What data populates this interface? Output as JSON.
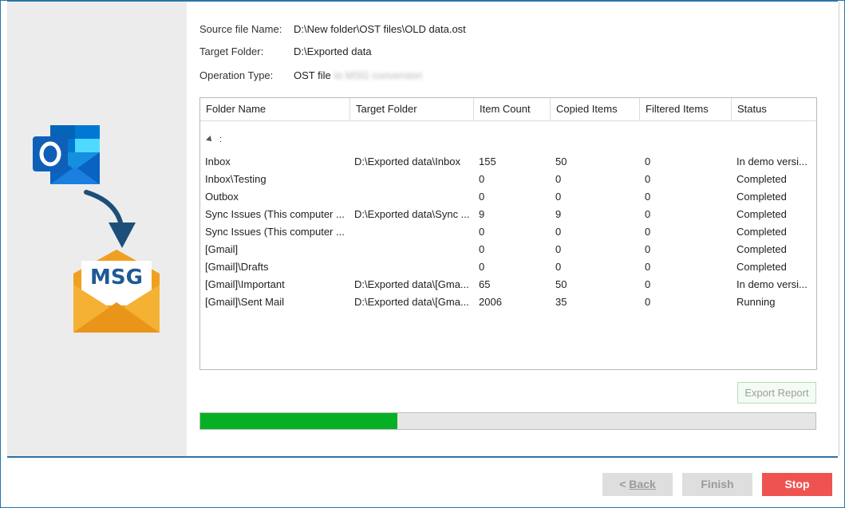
{
  "info": {
    "source_label": "Source file Name:",
    "source_value": "D:\\New folder\\OST files\\OLD data.ost",
    "target_label": "Target Folder:",
    "target_value": "D:\\Exported data",
    "operation_label": "Operation Type:",
    "operation_value": "OST file",
    "operation_blurred": "to MSG conversion"
  },
  "table": {
    "columns": [
      "Folder Name",
      "Target Folder",
      "Item Count",
      "Copied Items",
      "Filtered Items",
      "Status"
    ],
    "group_label": ":",
    "rows": [
      {
        "folder": "Inbox",
        "target": "D:\\Exported data\\Inbox",
        "count": "155",
        "copied": "50",
        "filtered": "0",
        "status": "In demo versi..."
      },
      {
        "folder": "Inbox\\Testing",
        "target": "",
        "count": "0",
        "copied": "0",
        "filtered": "0",
        "status": "Completed"
      },
      {
        "folder": "Outbox",
        "target": "",
        "count": "0",
        "copied": "0",
        "filtered": "0",
        "status": "Completed"
      },
      {
        "folder": "Sync Issues (This computer ...",
        "target": "D:\\Exported data\\Sync ...",
        "count": "9",
        "copied": "9",
        "filtered": "0",
        "status": "Completed"
      },
      {
        "folder": "Sync Issues (This computer ...",
        "target": "",
        "count": "0",
        "copied": "0",
        "filtered": "0",
        "status": "Completed"
      },
      {
        "folder": "[Gmail]",
        "target": "",
        "count": "0",
        "copied": "0",
        "filtered": "0",
        "status": "Completed"
      },
      {
        "folder": "[Gmail]\\Drafts",
        "target": "",
        "count": "0",
        "copied": "0",
        "filtered": "0",
        "status": "Completed"
      },
      {
        "folder": "[Gmail]\\Important",
        "target": "D:\\Exported data\\[Gma...",
        "count": "65",
        "copied": "50",
        "filtered": "0",
        "status": "In demo versi..."
      },
      {
        "folder": "[Gmail]\\Sent Mail",
        "target": "D:\\Exported data\\[Gma...",
        "count": "2006",
        "copied": "35",
        "filtered": "0",
        "status": "Running"
      }
    ]
  },
  "export_report_label": "Export Report",
  "progress_fraction": 0.32,
  "buttons": {
    "back_prefix": "< ",
    "back_label": "Back",
    "finish_label": "Finish",
    "stop_label": "Stop"
  },
  "illustration": {
    "badge_text": "MSG",
    "icons": [
      "outlook-icon",
      "curved-arrow-icon",
      "msg-envelope-icon"
    ]
  },
  "colors": {
    "accent": "#2a72a8",
    "progress": "#06b025",
    "stop": "#ef5350",
    "envelope": "#f5a623"
  }
}
